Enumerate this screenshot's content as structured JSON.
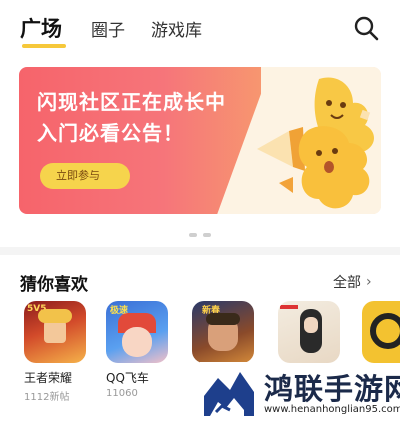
{
  "tabs": [
    {
      "label": "广场",
      "active": true
    },
    {
      "label": "圈子",
      "active": false
    },
    {
      "label": "游戏库",
      "active": false
    }
  ],
  "icons": {
    "search": "search-icon",
    "chevron": "chevron-right-icon"
  },
  "banner": {
    "title_line1": "闪现社区正在成长中",
    "title_line2": "入门必看公告！",
    "button_label": "立即参与",
    "page_count": 2,
    "active_page": 1
  },
  "section": {
    "title": "猜你喜欢",
    "more_label": "全部",
    "chevron": "›"
  },
  "games": [
    {
      "name": "王者荣耀",
      "sub": "1112新帖",
      "badge": "5V5"
    },
    {
      "name": "QQ飞车",
      "sub": "11060",
      "badge": "极速"
    },
    {
      "name": "",
      "sub": "",
      "badge": "新春"
    },
    {
      "name": "",
      "sub": "",
      "badge": ""
    },
    {
      "name": "",
      "sub": "",
      "badge": ""
    }
  ],
  "watermark": {
    "title": "鸿联手游网",
    "url": "www.henanhonglian95.com"
  },
  "colors": {
    "accent": "#f6c83a",
    "banner_red": "#f6646b",
    "banner_button": "#f6d44c",
    "watermark_navy": "#1b2a4a"
  }
}
